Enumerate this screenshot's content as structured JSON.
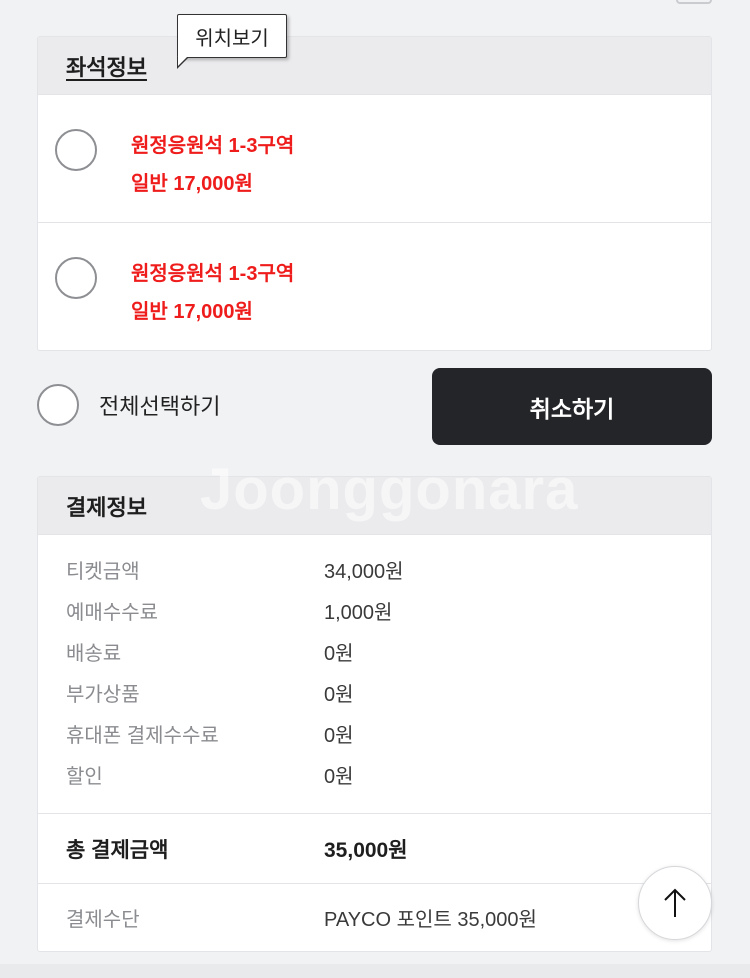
{
  "seat_info": {
    "title": "좌석정보",
    "location_tooltip": "위치보기",
    "seats": [
      {
        "section": "원정응원석 1-3구역",
        "price": "일반 17,000원"
      },
      {
        "section": "원정응원석 1-3구역",
        "price": "일반 17,000원"
      }
    ]
  },
  "actions": {
    "select_all_label": "전체선택하기",
    "cancel_label": "취소하기"
  },
  "watermark": "Joonggonara",
  "payment": {
    "title": "결제정보",
    "rows": [
      {
        "label": "티켓금액",
        "value": "34,000원"
      },
      {
        "label": "예매수수료",
        "value": "1,000원"
      },
      {
        "label": "배송료",
        "value": "0원"
      },
      {
        "label": "부가상품",
        "value": "0원"
      },
      {
        "label": "휴대폰 결제수수료",
        "value": "0원"
      },
      {
        "label": "할인",
        "value": "0원"
      }
    ],
    "total": {
      "label": "총 결제금액",
      "value": "35,000원"
    },
    "method": {
      "label": "결제수단",
      "value": "PAYCO 포인트 35,000원"
    }
  },
  "icons": {
    "scroll_top": "arrow-up-icon",
    "radio": "radio-unchecked-icon"
  },
  "colors": {
    "seat_text": "#ef1c1c",
    "cancel_button": "#242529",
    "header_bg": "#ebebee"
  }
}
